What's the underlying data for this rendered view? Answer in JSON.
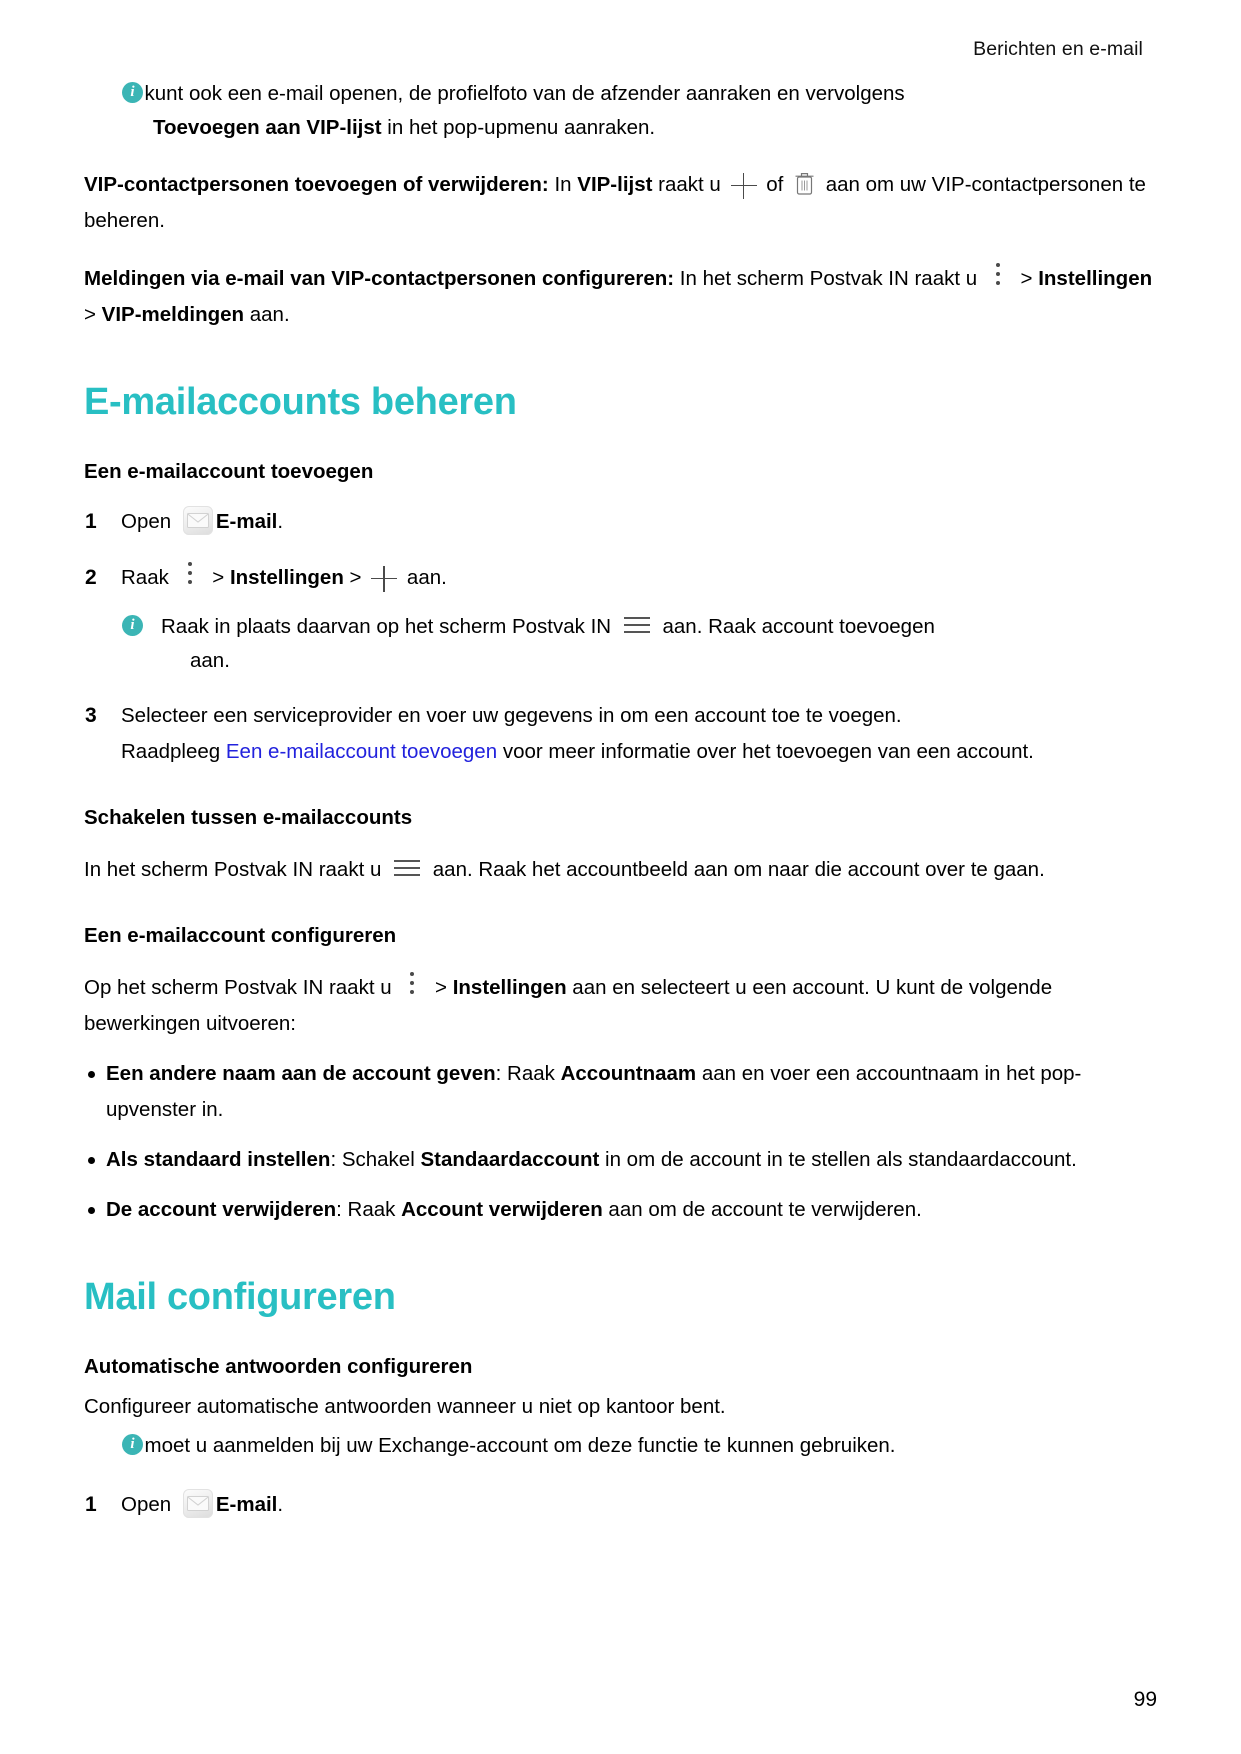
{
  "header": {
    "running_title": "Berichten en e-mail"
  },
  "footer": {
    "page_number": "99"
  },
  "colors": {
    "heading": "#28bfc3",
    "info_icon": "#3bb5b5",
    "link": "#2222dd"
  },
  "notes": {
    "vip_note": {
      "line1": "U kunt ook een e-mail openen, de profielfoto van de afzender aanraken en vervolgens",
      "bold_lead": "Toevoegen aan VIP-lijst",
      "line2_rest": " in het pop-upmenu aanraken."
    }
  },
  "paragraphs": {
    "vip_add_remove": {
      "bold_lead": "VIP-contactpersonen toevoegen of verwijderen:",
      "t1": " In ",
      "bold2": "VIP-lijst",
      "t2": " raakt u ",
      "t3": " of ",
      "t4": " aan om uw VIP-contactpersonen te beheren."
    },
    "vip_notifications": {
      "bold_lead": "Meldingen via e-mail van VIP-contactpersonen configureren:",
      "t1": " In het scherm Postvak IN raakt u ",
      "t2": " > ",
      "bold2": "Instellingen",
      "t3": " > ",
      "bold3": "VIP-meldingen",
      "t4": " aan."
    }
  },
  "sections": [
    {
      "id": "manage-accounts",
      "title": "E-mailaccounts beheren"
    },
    {
      "id": "configure-mail",
      "title": "Mail configureren"
    }
  ],
  "subheadings": {
    "add_account": "Een e-mailaccount toevoegen",
    "switch_accounts": "Schakelen tussen e-mailaccounts",
    "configure_account": "Een e-mailaccount configureren",
    "auto_reply": "Automatische antwoorden configureren"
  },
  "add_account_steps": [
    {
      "num": "1",
      "t1": "Open ",
      "bold1": "E-mail",
      "t2": "."
    },
    {
      "num": "2",
      "t1": "Raak ",
      "t2": " > ",
      "bold1": "Instellingen",
      "t3": " > ",
      "t4": " aan.",
      "note": {
        "t1": "Raak in plaats daarvan op het scherm Postvak IN ",
        "t2": " aan. Raak account toevoegen",
        "line2": "aan."
      }
    },
    {
      "num": "3",
      "t1": "Selecteer een serviceprovider en voer uw gegevens in om een account toe te voegen.",
      "t2": "Raadpleeg ",
      "link": "Een e-mailaccount toevoegen",
      "t3": " voor meer informatie over het toevoegen van een",
      "t4": "account."
    }
  ],
  "switch_accounts_body": {
    "t1": "In het scherm Postvak IN raakt u ",
    "t2": " aan. Raak het accountbeeld aan om naar die account over te gaan."
  },
  "configure_account_body": {
    "t1": "Op het scherm Postvak IN raakt u ",
    "t2": " > ",
    "bold1": "Instellingen",
    "t3": " aan en selecteert u een account. U kunt de volgende bewerkingen uitvoeren:"
  },
  "configure_account_bullets": [
    {
      "bold1": "Een andere naam aan de account geven",
      "t1": ": Raak ",
      "bold2": "Accountnaam",
      "t2": " aan en voer een accountnaam in het pop-upvenster in."
    },
    {
      "bold1": "Als standaard instellen",
      "t1": ": Schakel ",
      "bold2": "Standaardaccount",
      "t2": " in om de account in te stellen als standaardaccount."
    },
    {
      "bold1": "De account verwijderen",
      "t1": ": Raak ",
      "bold2": "Account verwijderen",
      "t2": " aan om de account te verwijderen."
    }
  ],
  "auto_reply": {
    "intro": "Configureer automatische antwoorden wanneer u niet op kantoor bent.",
    "note": "U moet u aanmelden bij uw Exchange-account om deze functie te kunnen gebruiken.",
    "step": {
      "num": "1",
      "t1": "Open ",
      "bold1": "E-mail",
      "t2": "."
    }
  },
  "icons": {
    "info": "info-icon",
    "plus": "plus-icon",
    "trash": "trash-icon",
    "overflow": "three-dots-vertical-icon",
    "hamburger": "hamburger-menu-icon",
    "mail": "mail-app-icon"
  }
}
